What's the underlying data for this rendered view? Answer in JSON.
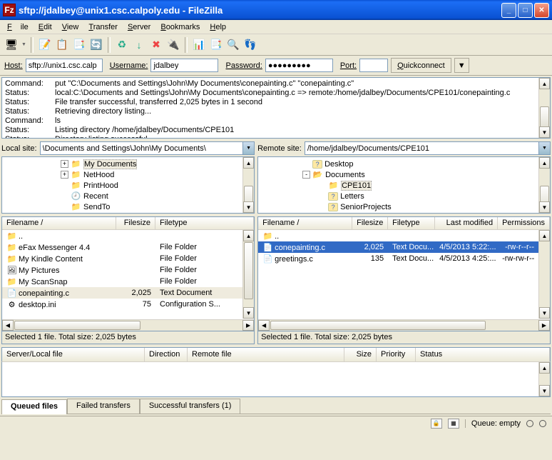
{
  "title": "sftp://jdalbey@unix1.csc.calpoly.edu - FileZilla",
  "menu": {
    "file": "File",
    "edit": "Edit",
    "view": "View",
    "transfer": "Transfer",
    "server": "Server",
    "bookmarks": "Bookmarks",
    "help": "Help"
  },
  "qc": {
    "host_label": "Host:",
    "host_value": "sftp://unix1.csc.calp",
    "user_label": "Username:",
    "user_value": "jdalbey",
    "pass_label": "Password:",
    "pass_value": "●●●●●●●●●",
    "port_label": "Port:",
    "port_value": "",
    "btn": "Quickconnect"
  },
  "log": [
    {
      "label": "Command:",
      "text": "put \"C:\\Documents and Settings\\John\\My Documents\\conepainting.c\" \"conepainting.c\""
    },
    {
      "label": "Status:",
      "text": "local:C:\\Documents and Settings\\John\\My Documents\\conepainting.c => remote:/home/jdalbey/Documents/CPE101/conepainting.c"
    },
    {
      "label": "Status:",
      "text": "File transfer successful, transferred 2,025 bytes in 1 second"
    },
    {
      "label": "Status:",
      "text": "Retrieving directory listing..."
    },
    {
      "label": "Command:",
      "text": "ls"
    },
    {
      "label": "Status:",
      "text": "Listing directory /home/jdalbey/Documents/CPE101"
    },
    {
      "label": "Status:",
      "text": "Directory listing successful"
    }
  ],
  "local": {
    "label": "Local site:",
    "path": "\\Documents and Settings\\John\\My Documents\\",
    "tree": [
      {
        "indent": 80,
        "toggle": "+",
        "icon": "📁",
        "name": "My Documents",
        "selected": true
      },
      {
        "indent": 80,
        "toggle": "+",
        "icon": "📁",
        "name": "NetHood"
      },
      {
        "indent": 80,
        "toggle": "",
        "icon": "📁",
        "name": "PrintHood"
      },
      {
        "indent": 80,
        "toggle": "",
        "icon": "🕘",
        "name": "Recent"
      },
      {
        "indent": 80,
        "toggle": "",
        "icon": "📁",
        "name": "SendTo"
      }
    ],
    "cols": {
      "filename": "Filename  /",
      "filesize": "Filesize",
      "filetype": "Filetype"
    },
    "files": [
      {
        "icon": "📁",
        "name": "..",
        "size": "",
        "type": ""
      },
      {
        "icon": "📁",
        "name": "eFax Messenger 4.4",
        "size": "",
        "type": "File Folder"
      },
      {
        "icon": "📁",
        "name": "My Kindle Content",
        "size": "",
        "type": "File Folder"
      },
      {
        "icon": "🖼",
        "name": "My Pictures",
        "size": "",
        "type": "File Folder"
      },
      {
        "icon": "📁",
        "name": "My ScanSnap",
        "size": "",
        "type": "File Folder"
      },
      {
        "icon": "📄",
        "name": "conepainting.c",
        "size": "2,025",
        "type": "Text Document",
        "selected": true
      },
      {
        "icon": "⚙",
        "name": "desktop.ini",
        "size": "75",
        "type": "Configuration S..."
      }
    ],
    "status": "Selected 1 file. Total size: 2,025 bytes"
  },
  "remote": {
    "label": "Remote site:",
    "path": "/home/jdalbey/Documents/CPE101",
    "tree": [
      {
        "indent": 60,
        "toggle": "",
        "icon": "?",
        "name": "Desktop"
      },
      {
        "indent": 60,
        "toggle": "-",
        "icon": "📂",
        "name": "Documents"
      },
      {
        "indent": 82,
        "toggle": "",
        "icon": "📁",
        "name": "CPE101",
        "selected": true
      },
      {
        "indent": 82,
        "toggle": "",
        "icon": "?",
        "name": "Letters"
      },
      {
        "indent": 82,
        "toggle": "",
        "icon": "?",
        "name": "SeniorProjects"
      }
    ],
    "cols": {
      "filename": "Filename  /",
      "filesize": "Filesize",
      "filetype": "Filetype",
      "modified": "Last modified",
      "perms": "Permissions"
    },
    "files": [
      {
        "icon": "📁",
        "name": "..",
        "size": "",
        "type": "",
        "mod": "",
        "perm": ""
      },
      {
        "icon": "📄",
        "name": "conepainting.c",
        "size": "2,025",
        "type": "Text Docu...",
        "mod": "4/5/2013 5:22:...",
        "perm": "-rw-r--r--",
        "selected": true
      },
      {
        "icon": "📄",
        "name": "greetings.c",
        "size": "135",
        "type": "Text Docu...",
        "mod": "4/5/2013 4:25:...",
        "perm": "-rw-rw-r--"
      }
    ],
    "status": "Selected 1 file. Total size: 2,025 bytes"
  },
  "queue_cols": {
    "server": "Server/Local file",
    "direction": "Direction",
    "remote": "Remote file",
    "size": "Size",
    "priority": "Priority",
    "status": "Status"
  },
  "tabs": {
    "queued": "Queued files",
    "failed": "Failed transfers",
    "successful": "Successful transfers (1)"
  },
  "status_bar": {
    "queue": "Queue: empty"
  }
}
